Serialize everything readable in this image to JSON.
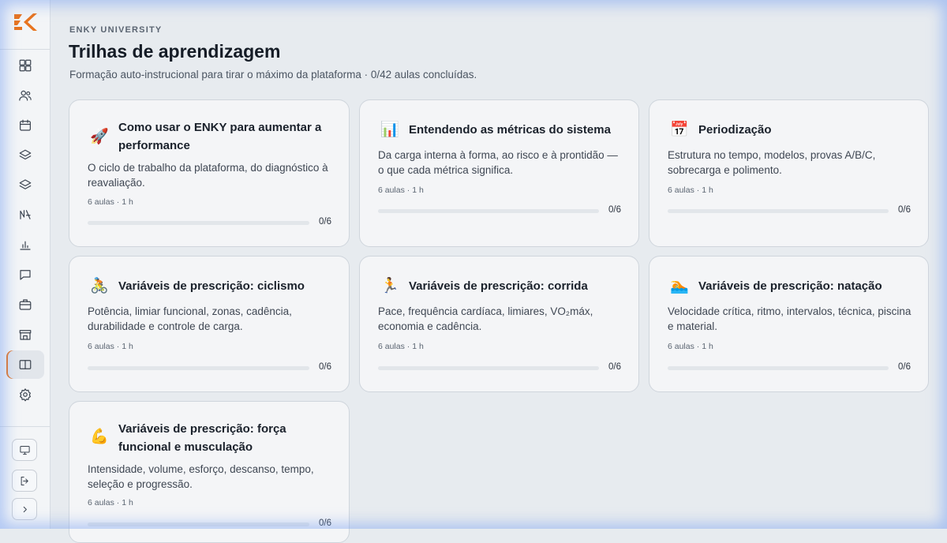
{
  "brand": {
    "accent": "#e8741f"
  },
  "sidebar": {
    "items": [
      {
        "name": "dashboard-icon",
        "active": false
      },
      {
        "name": "users-icon",
        "active": false
      },
      {
        "name": "calendar-icon",
        "active": false
      },
      {
        "name": "layers-icon",
        "active": false
      },
      {
        "name": "stack-icon",
        "active": false
      },
      {
        "name": "trend-icon",
        "active": false
      },
      {
        "name": "bar-chart-icon",
        "active": false
      },
      {
        "name": "chat-icon",
        "active": false
      },
      {
        "name": "briefcase-icon",
        "active": false
      },
      {
        "name": "store-icon",
        "active": false
      },
      {
        "name": "book-icon",
        "active": true
      },
      {
        "name": "gear-icon",
        "active": false
      }
    ],
    "bottom": [
      "monitor-icon",
      "logout-icon",
      "chevron-right-icon"
    ]
  },
  "header": {
    "eyebrow": "ENKY UNIVERSITY",
    "title": "Trilhas de aprendizagem",
    "subtitle": "Formação auto-instrucional para tirar o máximo da plataforma · 0/42 aulas concluídas."
  },
  "tracks": [
    {
      "icon": "rocket-icon",
      "emoji": "🚀",
      "title": "Como usar o ENKY para aumentar a performance",
      "description": "O ciclo de trabalho da plataforma, do diagnóstico à reavaliação.",
      "meta": "6 aulas · 1 h",
      "progress_label": "0/6",
      "progress": 0
    },
    {
      "icon": "bar-chart-emoji-icon",
      "emoji": "📊",
      "title": "Entendendo as métricas do sistema",
      "description": "Da carga interna à forma, ao risco e à prontidão — o que cada métrica significa.",
      "meta": "6 aulas · 1 h",
      "progress_label": "0/6",
      "progress": 0
    },
    {
      "icon": "calendar-emoji-icon",
      "emoji": "📅",
      "title": "Periodização",
      "description": "Estrutura no tempo, modelos, provas A/B/C, sobrecarga e polimento.",
      "meta": "6 aulas · 1 h",
      "progress_label": "0/6",
      "progress": 0
    },
    {
      "icon": "cyclist-icon",
      "emoji": "🚴",
      "title": "Variáveis de prescrição: ciclismo",
      "description": "Potência, limiar funcional, zonas, cadência, durabilidade e controle de carga.",
      "meta": "6 aulas · 1 h",
      "progress_label": "0/6",
      "progress": 0
    },
    {
      "icon": "runner-icon",
      "emoji": "🏃",
      "title": "Variáveis de prescrição: corrida",
      "description": "Pace, frequência cardíaca, limiares, VO₂máx, economia e cadência.",
      "meta": "6 aulas · 1 h",
      "progress_label": "0/6",
      "progress": 0
    },
    {
      "icon": "swimmer-icon",
      "emoji": "🏊",
      "title": "Variáveis de prescrição: natação",
      "description": "Velocidade crítica, ritmo, intervalos, técnica, piscina e material.",
      "meta": "6 aulas · 1 h",
      "progress_label": "0/6",
      "progress": 0
    },
    {
      "icon": "biceps-icon",
      "emoji": "💪",
      "title": "Variáveis de prescrição: força funcional e musculação",
      "description": "Intensidade, volume, esforço, descanso, tempo, seleção e progressão.",
      "meta": "6 aulas · 1 h",
      "progress_label": "0/6",
      "progress": 0
    }
  ]
}
